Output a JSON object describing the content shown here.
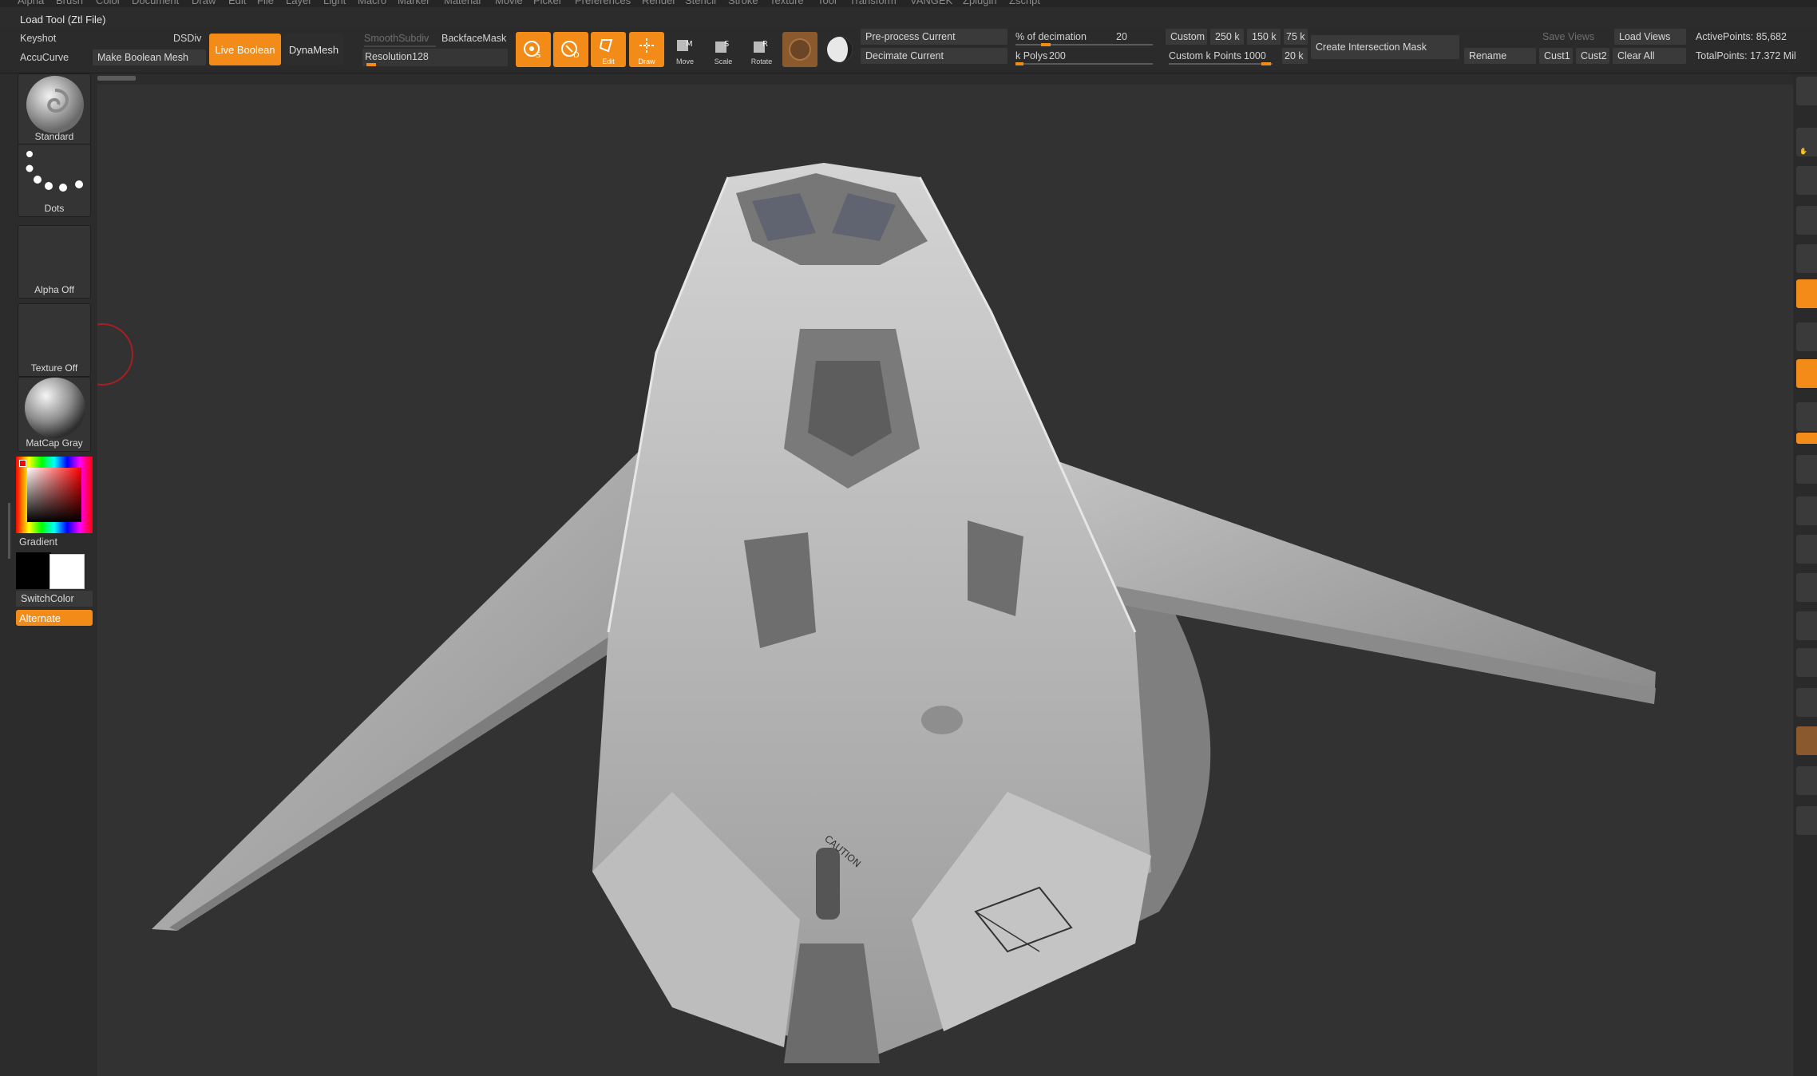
{
  "menu": [
    "Alpha",
    "Brush",
    "Color",
    "Document",
    "Draw",
    "Edit",
    "File",
    "Layer",
    "Light",
    "Macro",
    "Marker",
    "Material",
    "Movie",
    "Picker",
    "Preferences",
    "Render",
    "Stencil",
    "Stroke",
    "Texture",
    "Tool",
    "Transform",
    "VANGEK",
    "Zplugin",
    "Zscript"
  ],
  "load_tool": "Load Tool (Ztl File)",
  "shelf": {
    "keyshot": "Keyshot",
    "dsdiv": "DSDiv",
    "accucurve": "AccuCurve",
    "make_boolean_mesh": "Make Boolean Mesh",
    "live_boolean": "Live Boolean",
    "dynamesh": "DynaMesh",
    "smoothsubdiv": "SmoothSubdiv",
    "backfacemask": "BackfaceMask",
    "resolution_label": "Resolution",
    "resolution_value": "128",
    "edit": "Edit",
    "draw": "Draw",
    "move": "Move",
    "scale": "Scale",
    "rotate": "Rotate",
    "preprocess_current": "Pre-process Current",
    "decimate_current": "Decimate Current",
    "pct_decimation_label": "% of decimation",
    "pct_decimation_value": "20",
    "kpolys_label": "k Polys",
    "kpolys_value": "200",
    "custom": "Custom",
    "k250": "250 k",
    "k150": "150 k",
    "k75": "75 k",
    "custom_kpoints_label": "Custom k Points",
    "custom_kpoints_value": "1000",
    "k20": "20 k",
    "create_intersection_mask": "Create Intersection Mask",
    "save_views": "Save Views",
    "load_views": "Load Views",
    "rename": "Rename",
    "cust1": "Cust1",
    "cust2": "Cust2",
    "clear_all": "Clear All",
    "active_points": "ActivePoints: 85,682",
    "total_points": "TotalPoints: 17.372 Mil"
  },
  "left": {
    "brush": "Standard",
    "stroke": "Dots",
    "alpha": "Alpha Off",
    "texture": "Texture Off",
    "material": "MatCap Gray",
    "gradient": "Gradient",
    "switchcolor": "SwitchColor",
    "alternate": "Alternate"
  },
  "model_decals": {
    "caution": "CAUTION"
  },
  "colors": {
    "accent": "#f28b18",
    "ui_bg": "#2c2c2c",
    "viewport_bg": "#323232"
  }
}
